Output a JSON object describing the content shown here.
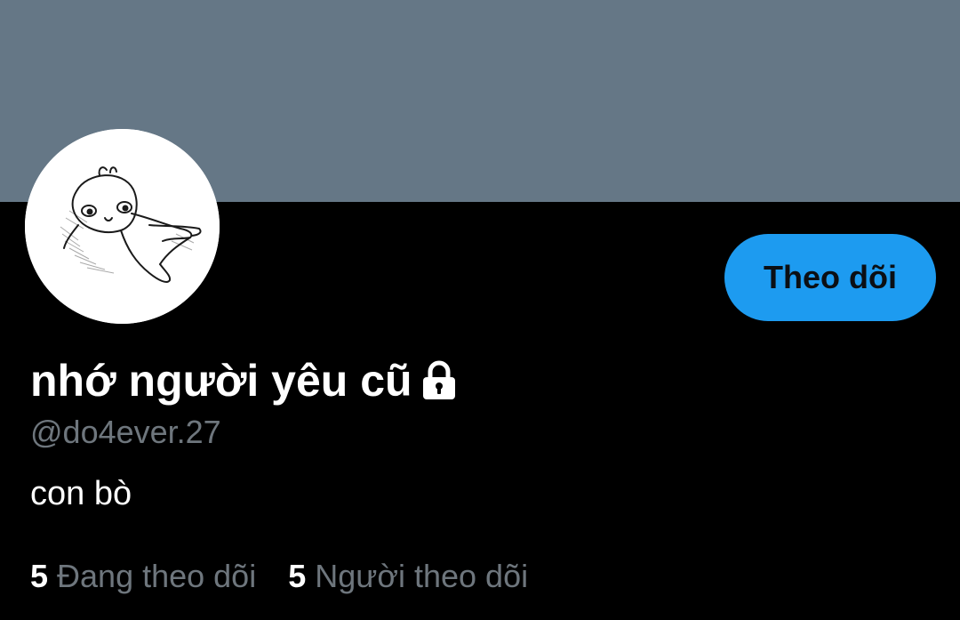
{
  "colors": {
    "background": "#000000",
    "banner": "#657786",
    "accent": "#1d9bf0",
    "text_primary": "#ffffff",
    "text_secondary": "#6e767d"
  },
  "profile": {
    "display_name": "nhớ người yêu cũ",
    "handle": "@do4ever.27",
    "bio": "con bò",
    "protected_icon": "lock-icon",
    "avatar_icon": "doodle-avatar"
  },
  "follow_button": {
    "label": "Theo dõi"
  },
  "stats": {
    "following": {
      "count": "5",
      "label": "Đang theo dõi"
    },
    "followers": {
      "count": "5",
      "label": "Người theo dõi"
    }
  }
}
